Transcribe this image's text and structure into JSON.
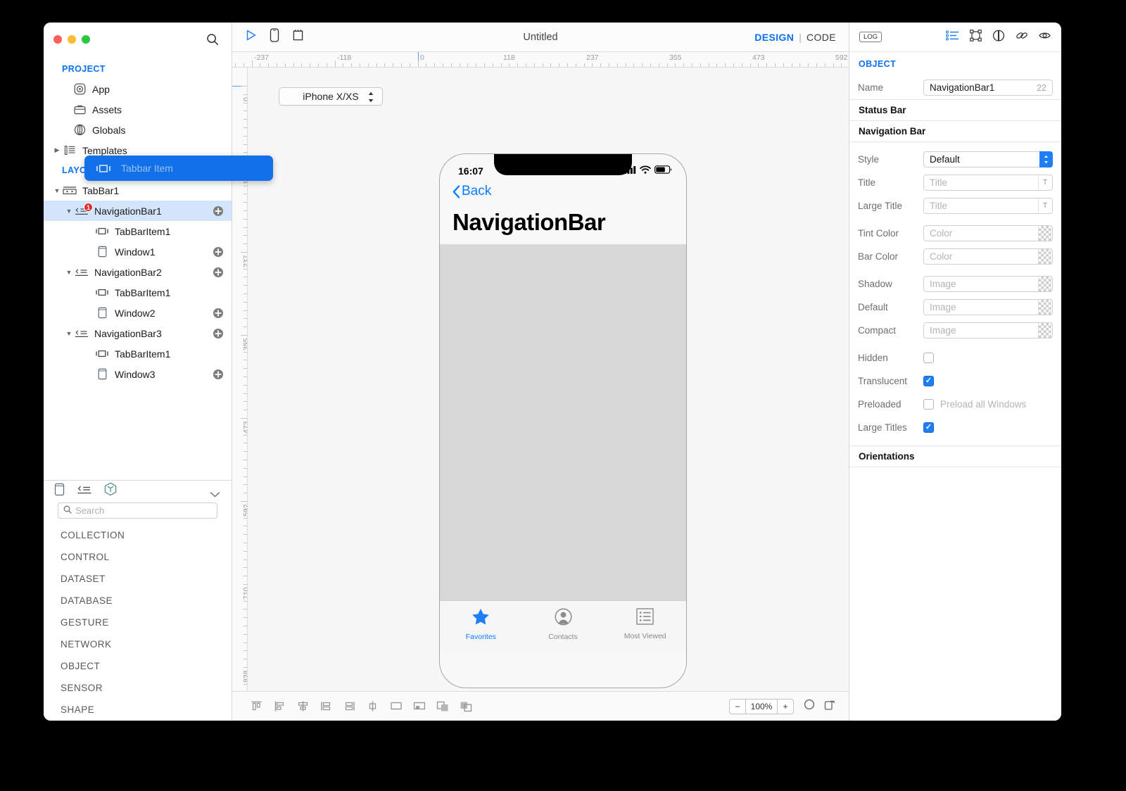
{
  "window": {
    "title": "Untitled",
    "traffic_lights": [
      "close",
      "minimize",
      "zoom"
    ]
  },
  "sidebar": {
    "project_group_label": "PROJECT",
    "project_items": [
      {
        "label": "App",
        "icon": "app-icon"
      },
      {
        "label": "Assets",
        "icon": "assets-icon"
      },
      {
        "label": "Globals",
        "icon": "globals-icon"
      },
      {
        "label": "Templates",
        "icon": "templates-icon"
      }
    ],
    "layout_group_label": "LAYOUT",
    "layout_items": [
      {
        "label": "TabBar1",
        "icon": "tabbar-icon",
        "indent": 0,
        "disclosure": "open",
        "plus": false,
        "badge": null,
        "selected": false
      },
      {
        "label": "NavigationBar1",
        "icon": "navbar-icon",
        "indent": 1,
        "disclosure": "open",
        "plus": true,
        "badge": "1",
        "selected": true
      },
      {
        "label": "TabBarItem1",
        "icon": "tabbaritem-icon",
        "indent": 2,
        "disclosure": "none",
        "plus": false,
        "badge": null,
        "selected": false
      },
      {
        "label": "Window1",
        "icon": "window-icon",
        "indent": 2,
        "disclosure": "none",
        "plus": true,
        "badge": null,
        "selected": false
      },
      {
        "label": "NavigationBar2",
        "icon": "navbar-icon",
        "indent": 1,
        "disclosure": "open",
        "plus": true,
        "badge": null,
        "selected": false
      },
      {
        "label": "TabBarItem1",
        "icon": "tabbaritem-icon",
        "indent": 2,
        "disclosure": "none",
        "plus": false,
        "badge": null,
        "selected": false
      },
      {
        "label": "Window2",
        "icon": "window-icon",
        "indent": 2,
        "disclosure": "none",
        "plus": true,
        "badge": null,
        "selected": false
      },
      {
        "label": "NavigationBar3",
        "icon": "navbar-icon",
        "indent": 1,
        "disclosure": "open",
        "plus": true,
        "badge": null,
        "selected": false
      },
      {
        "label": "TabBarItem1",
        "icon": "tabbaritem-icon",
        "indent": 2,
        "disclosure": "none",
        "plus": false,
        "badge": null,
        "selected": false
      },
      {
        "label": "Window3",
        "icon": "window-icon",
        "indent": 2,
        "disclosure": "none",
        "plus": true,
        "badge": null,
        "selected": false
      }
    ]
  },
  "drag_chip": {
    "label": "Tabbar Item",
    "icon": "tabbaritem-icon",
    "background": "#1271e8",
    "text_color": "#95c0f3"
  },
  "library": {
    "tabs": [
      {
        "icon": "window-icon",
        "name": "window-tab"
      },
      {
        "icon": "navbar-icon",
        "name": "navbar-tab"
      },
      {
        "icon": "object-cube-icon",
        "name": "object-tab"
      }
    ],
    "collapse_icon": "chevron-down-icon",
    "search_placeholder": "Search",
    "search_value": "",
    "categories": [
      "COLLECTION",
      "CONTROL",
      "DATASET",
      "DATABASE",
      "GESTURE",
      "NETWORK",
      "OBJECT",
      "SENSOR",
      "SHAPE"
    ]
  },
  "toolbar": {
    "run_icon": "play-icon",
    "device_icon": "device-icon",
    "widget_icon": "widget-icon",
    "design_label": "DESIGN",
    "separator": "|",
    "code_label": "CODE",
    "accent": "#0a72f5"
  },
  "canvas": {
    "device_selector": "iPhone X/XS",
    "ruler_h_labels": [
      "-237",
      "-118",
      "0",
      "118",
      "237",
      "355",
      "473",
      "592"
    ],
    "ruler_v_labels": [
      "0",
      "118",
      "237",
      "355",
      "473",
      "592",
      "710",
      "828"
    ]
  },
  "phone": {
    "status_time": "16:07",
    "status_icons": [
      "cellular-icon",
      "wifi-icon",
      "battery-icon"
    ],
    "back_label": "Back",
    "large_title": "NavigationBar",
    "tabbar_items": [
      {
        "label": "Favorites",
        "icon": "star-icon",
        "active": true
      },
      {
        "label": "Contacts",
        "icon": "contact-icon",
        "active": false
      },
      {
        "label": "Most Viewed",
        "icon": "list-icon",
        "active": false
      }
    ]
  },
  "bottombar": {
    "align_icons": [
      "align-top-icon",
      "align-left-icon",
      "align-center-horizontal-icon",
      "align-text-left-icon",
      "align-text-right-icon",
      "align-middle-icon",
      "fit-parent-icon",
      "distribute-icon",
      "bring-forward-icon",
      "send-backward-icon"
    ],
    "zoom_minus": "−",
    "zoom_value": "100%",
    "zoom_plus": "+",
    "right_icons": [
      "zoom-fit-icon",
      "rotate-icon"
    ]
  },
  "inspector": {
    "log_label": "LOG",
    "tab_icons": [
      "attributes-icon",
      "layout-icon",
      "appearance-icon",
      "connections-icon",
      "preview-icon"
    ],
    "heading": "OBJECT",
    "name_label": "Name",
    "name_value": "NavigationBar1",
    "name_count": "22",
    "sections": [
      {
        "title": "Status Bar",
        "rows": []
      },
      {
        "title": "Navigation Bar",
        "rows": [
          {
            "label": "Style",
            "type": "select",
            "value": "Default"
          },
          {
            "label": "Title",
            "type": "text",
            "placeholder": "Title",
            "value": "",
            "suffix": "T"
          },
          {
            "label": "Large Title",
            "type": "text",
            "placeholder": "Title",
            "value": "",
            "suffix": "T"
          },
          {
            "label": "Tint Color",
            "type": "color",
            "placeholder": "Color",
            "value": ""
          },
          {
            "label": "Bar Color",
            "type": "color",
            "placeholder": "Color",
            "value": ""
          },
          {
            "label": "Shadow",
            "type": "image",
            "placeholder": "Image",
            "value": ""
          },
          {
            "label": "Default",
            "type": "image",
            "placeholder": "Image",
            "value": ""
          },
          {
            "label": "Compact",
            "type": "image",
            "placeholder": "Image",
            "value": ""
          },
          {
            "label": "Hidden",
            "type": "checkbox",
            "checked": false,
            "text": ""
          },
          {
            "label": "Translucent",
            "type": "checkbox",
            "checked": true,
            "text": ""
          },
          {
            "label": "Preloaded",
            "type": "checkbox",
            "checked": false,
            "text": "Preload all Windows"
          },
          {
            "label": "Large Titles",
            "type": "checkbox",
            "checked": true,
            "text": ""
          }
        ]
      },
      {
        "title": "Orientations",
        "rows": []
      }
    ]
  }
}
